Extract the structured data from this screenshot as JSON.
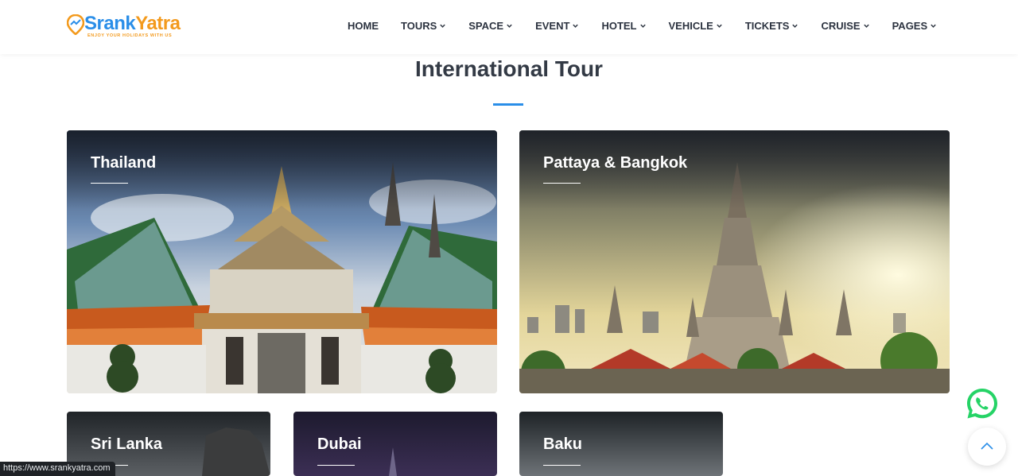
{
  "brand": {
    "name_part1": "Srank",
    "name_part2": "Yatra",
    "tagline": "ENJOY YOUR HOLIDAYS WITH US",
    "colors": {
      "blue": "#2a8ee8",
      "orange": "#f39a1d"
    }
  },
  "nav": {
    "items": [
      {
        "label": "HOME",
        "has_dropdown": false
      },
      {
        "label": "TOURS",
        "has_dropdown": true
      },
      {
        "label": "SPACE",
        "has_dropdown": true
      },
      {
        "label": "EVENT",
        "has_dropdown": true
      },
      {
        "label": "HOTEL",
        "has_dropdown": true
      },
      {
        "label": "VEHICLE",
        "has_dropdown": true
      },
      {
        "label": "TICKETS",
        "has_dropdown": true
      },
      {
        "label": "CRUISE",
        "has_dropdown": true
      },
      {
        "label": "PAGES",
        "has_dropdown": true
      }
    ],
    "dropdown_icon": "chevron-down-icon"
  },
  "section": {
    "title": "International Tour",
    "accent": "#2a8ee8"
  },
  "destinations": [
    {
      "label": "Thailand"
    },
    {
      "label": "Pattaya & Bangkok"
    },
    {
      "label": "Sri Lanka"
    },
    {
      "label": "Dubai"
    },
    {
      "label": "Baku"
    }
  ],
  "floating": {
    "whatsapp_icon": "whatsapp-icon",
    "whatsapp_color": "#25d366",
    "scroll_top_icon": "chevron-up-icon"
  },
  "status_bar": {
    "url": "https://www.srankyatra.com"
  }
}
